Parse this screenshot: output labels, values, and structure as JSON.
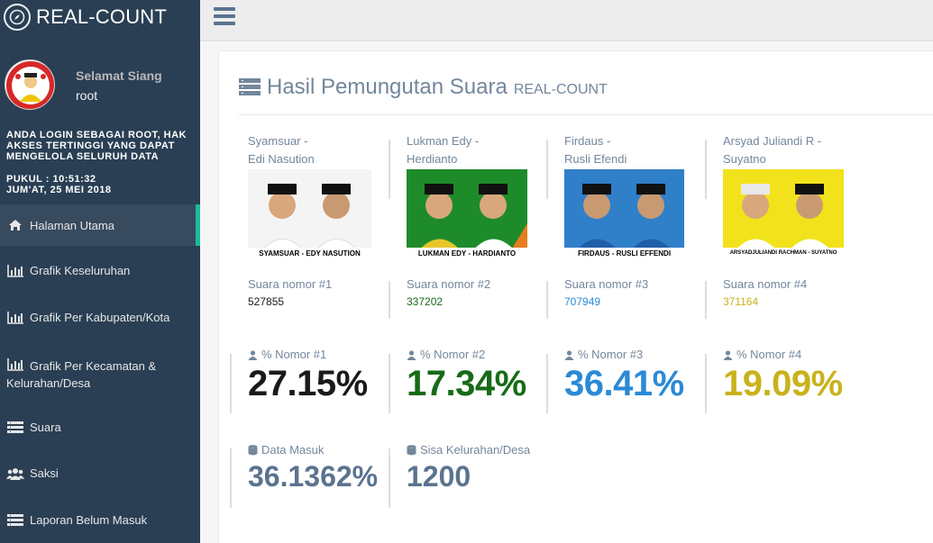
{
  "app": {
    "title": "REAL-COUNT"
  },
  "profile": {
    "greeting": "Selamat Siang",
    "username": "root"
  },
  "login_note": "ANDA LOGIN SEBAGAI ROOT, HAK AKSES TERTINGGI YANG DAPAT MENGELOLA SELURUH DATA",
  "clock": {
    "time": "PUKUL : 10:51:32",
    "date": "JUM'AT, 25 MEI 2018"
  },
  "menu": [
    {
      "label": "Halaman Utama",
      "icon": "home-icon"
    },
    {
      "label": "Grafik Keseluruhan",
      "icon": "bar-chart-icon"
    },
    {
      "label": "Grafik Per Kabupaten/Kota",
      "icon": "bar-chart-icon"
    },
    {
      "label_line1": "Grafik Per Kecamatan &",
      "label_line2": "Kelurahan/Desa",
      "icon": "bar-chart-icon"
    },
    {
      "label": "Suara",
      "icon": "list-icon"
    },
    {
      "label": "Saksi",
      "icon": "users-icon"
    },
    {
      "label": "Laporan Belum Masuk",
      "icon": "list-icon"
    }
  ],
  "panel": {
    "title": "Hasil Pemungutan Suara",
    "subtitle": "REAL-COUNT"
  },
  "candidates": [
    {
      "name_line1": "Syamsuar -",
      "name_line2": "Edi Nasution",
      "caption": "SYAMSUAR - EDY NASUTION",
      "vote_label": "Suara nomor #1",
      "votes": "527855",
      "pct_label": "% Nomor #1",
      "pct": "27.15%",
      "color": "#1a1a1a",
      "photo_bg": "#f4f4f4"
    },
    {
      "name_line1": "Lukman Edy -",
      "name_line2": "Herdianto",
      "caption": "LUKMAN EDY - HARDIANTO",
      "vote_label": "Suara nomor #2",
      "votes": "337202",
      "pct_label": "% Nomor #2",
      "pct": "17.34%",
      "color": "#166b16",
      "photo_bg": "#1e8b2a"
    },
    {
      "name_line1": "Firdaus -",
      "name_line2": "Rusli Efendi",
      "caption": "FIRDAUS - RUSLI EFFENDI",
      "vote_label": "Suara nomor #3",
      "votes": "707949",
      "pct_label": "% Nomor #3",
      "pct": "36.41%",
      "color": "#2b8ad6",
      "photo_bg": "#2f7fc9"
    },
    {
      "name_line1": "Arsyad Juliandi R -",
      "name_line2": "Suyatno",
      "caption": "ARSYADJULIANDI RACHMAN - SUYATNO",
      "vote_label": "Suara nomor #4",
      "votes": "371164",
      "pct_label": "% Nomor #4",
      "pct": "19.09%",
      "color": "#c9b21a",
      "photo_bg": "#f2e21b"
    }
  ],
  "stats": {
    "data_masuk_label": "Data Masuk",
    "data_masuk": "36.1362%",
    "sisa_label": "Sisa Kelurahan/Desa",
    "sisa": "1200"
  }
}
